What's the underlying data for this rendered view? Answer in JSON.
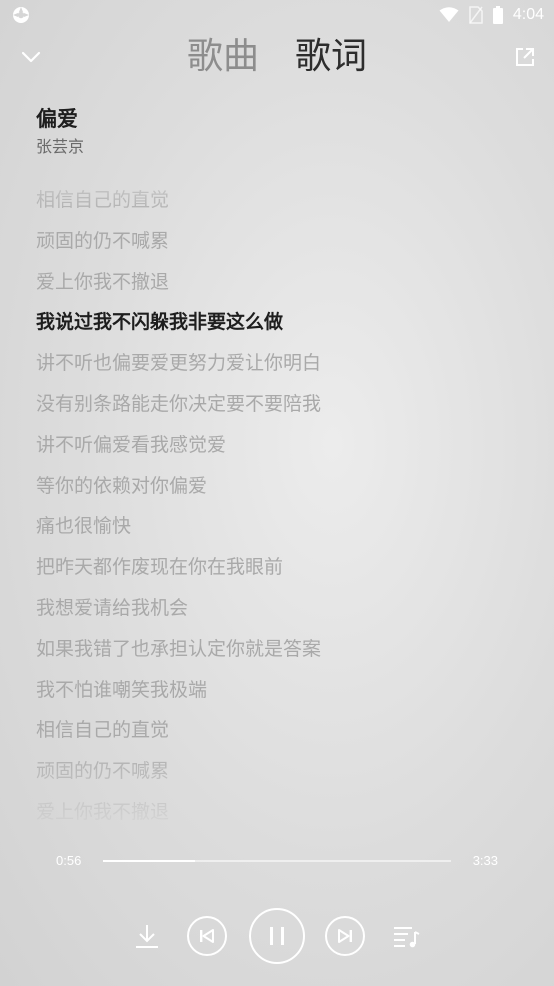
{
  "status_bar": {
    "time": "4:04",
    "icons": [
      "app-icon",
      "wifi-icon",
      "no-sim-icon",
      "battery-icon"
    ]
  },
  "header": {
    "tabs": [
      {
        "label": "歌曲",
        "active": false
      },
      {
        "label": "歌词",
        "active": true
      }
    ],
    "icons": [
      "chevron-down-icon",
      "share-icon"
    ]
  },
  "song": {
    "title": "偏爱",
    "artist": "张芸京"
  },
  "lyrics": {
    "current_index": 3,
    "lines": [
      "相信自己的直觉",
      "顽固的仍不喊累",
      "爱上你我不撤退",
      "我说过我不闪躲我非要这么做",
      "讲不听也偏要爱更努力爱让你明白",
      "没有别条路能走你决定要不要陪我",
      "讲不听偏爱看我感觉爱",
      "等你的依赖对你偏爱",
      "痛也很愉快",
      "把昨天都作废现在你在我眼前",
      "我想爱请给我机会",
      "如果我错了也承担认定你就是答案",
      "我不怕谁嘲笑我极端",
      "相信自己的直觉",
      "顽固的仍不喊累",
      "爱上你我不撤退"
    ]
  },
  "playback": {
    "elapsed": "0:56",
    "total": "3:33",
    "progress": 0.265
  },
  "controls": {
    "icons": [
      "download-icon",
      "previous-icon",
      "pause-icon",
      "next-icon",
      "playlist-icon"
    ]
  },
  "colors": {
    "background": "#dcdcdc",
    "active_text": "#1e1e1e",
    "inactive_text": "#a9a9a9",
    "controls": "#ffffff"
  }
}
